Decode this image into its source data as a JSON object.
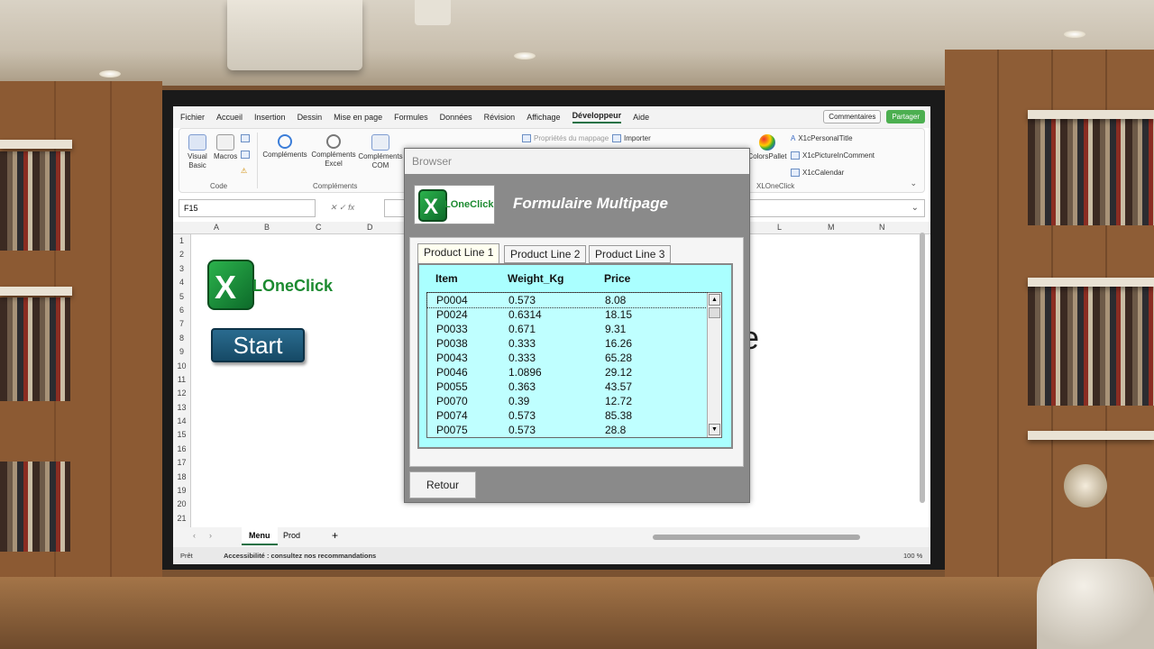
{
  "excel": {
    "menu": [
      "Fichier",
      "Accueil",
      "Insertion",
      "Dessin",
      "Mise en page",
      "Formules",
      "Données",
      "Révision",
      "Affichage",
      "Développeur",
      "Aide"
    ],
    "active_menu": "Développeur",
    "comments_label": "Commentaires",
    "share_label": "Partager",
    "ribbon": {
      "visual_basic": "Visual Basic",
      "macros": "Macros",
      "group_code": "Code",
      "complements": "Compléments",
      "complements_excel": "Compléments Excel",
      "complements_com": "Compléments COM",
      "group_complements": "Compléments",
      "proprietes_mappage": "Propriétés du mappage",
      "importer": "Importer",
      "colors_pallet": "ColorsPallet",
      "x1c_personal_title": "X1cPersonalTitle",
      "x1c_picture_in_comment": "X1cPictureInComment",
      "x1c_calendar": "X1cCalendar",
      "group_xlonclick": "XLOneClick"
    },
    "name_box": "F15",
    "columns": [
      "A",
      "B",
      "C",
      "D",
      "L",
      "M",
      "N"
    ],
    "rows": [
      "1",
      "2",
      "3",
      "4",
      "5",
      "6",
      "7",
      "8",
      "9",
      "10",
      "11",
      "12",
      "13",
      "14",
      "15",
      "16",
      "17",
      "18",
      "19",
      "20",
      "21"
    ],
    "start_label": "Start",
    "sheet_tabs": [
      "Menu",
      "Prod"
    ],
    "active_sheet": "Menu",
    "add_sheet": "+",
    "status_ready": "Prêt",
    "accessibility": "Accessibilité : consultez nos recommandations",
    "zoom": "100 %"
  },
  "logo": {
    "xl": "X",
    "text_l": "L",
    "text_one": "One",
    "text_click": "Click"
  },
  "form": {
    "title": "Browser",
    "heading": "Formulaire Multipage",
    "tabs": [
      "Product Line 1",
      "Product Line 2",
      "Product Line 3"
    ],
    "active_tab": "Product Line 1",
    "columns": [
      "Item",
      "Weight_Kg",
      "Price"
    ],
    "rows": [
      {
        "item": "P0004",
        "weight": "0.573",
        "price": "8.08"
      },
      {
        "item": "P0024",
        "weight": "0.6314",
        "price": "18.15"
      },
      {
        "item": "P0033",
        "weight": "0.671",
        "price": "9.31"
      },
      {
        "item": "P0038",
        "weight": "0.333",
        "price": "16.26"
      },
      {
        "item": "P0043",
        "weight": "0.333",
        "price": "65.28"
      },
      {
        "item": "P0046",
        "weight": "1.0896",
        "price": "29.12"
      },
      {
        "item": "P0055",
        "weight": "0.363",
        "price": "43.57"
      },
      {
        "item": "P0070",
        "weight": "0.39",
        "price": "12.72"
      },
      {
        "item": "P0074",
        "weight": "0.573",
        "price": "85.38"
      },
      {
        "item": "P0075",
        "weight": "0.573",
        "price": "28.8"
      }
    ],
    "return_label": "Retour"
  },
  "colors": {
    "excel_green": "#1e7145",
    "listbox_bg": "#bfffff",
    "form_gray": "#8a8a8a"
  },
  "icons": [
    "visual-basic-icon",
    "macros-icon",
    "gear-icon",
    "colors-pallet-icon",
    "chevron-down-icon",
    "scroll-up-icon",
    "scroll-down-icon"
  ]
}
